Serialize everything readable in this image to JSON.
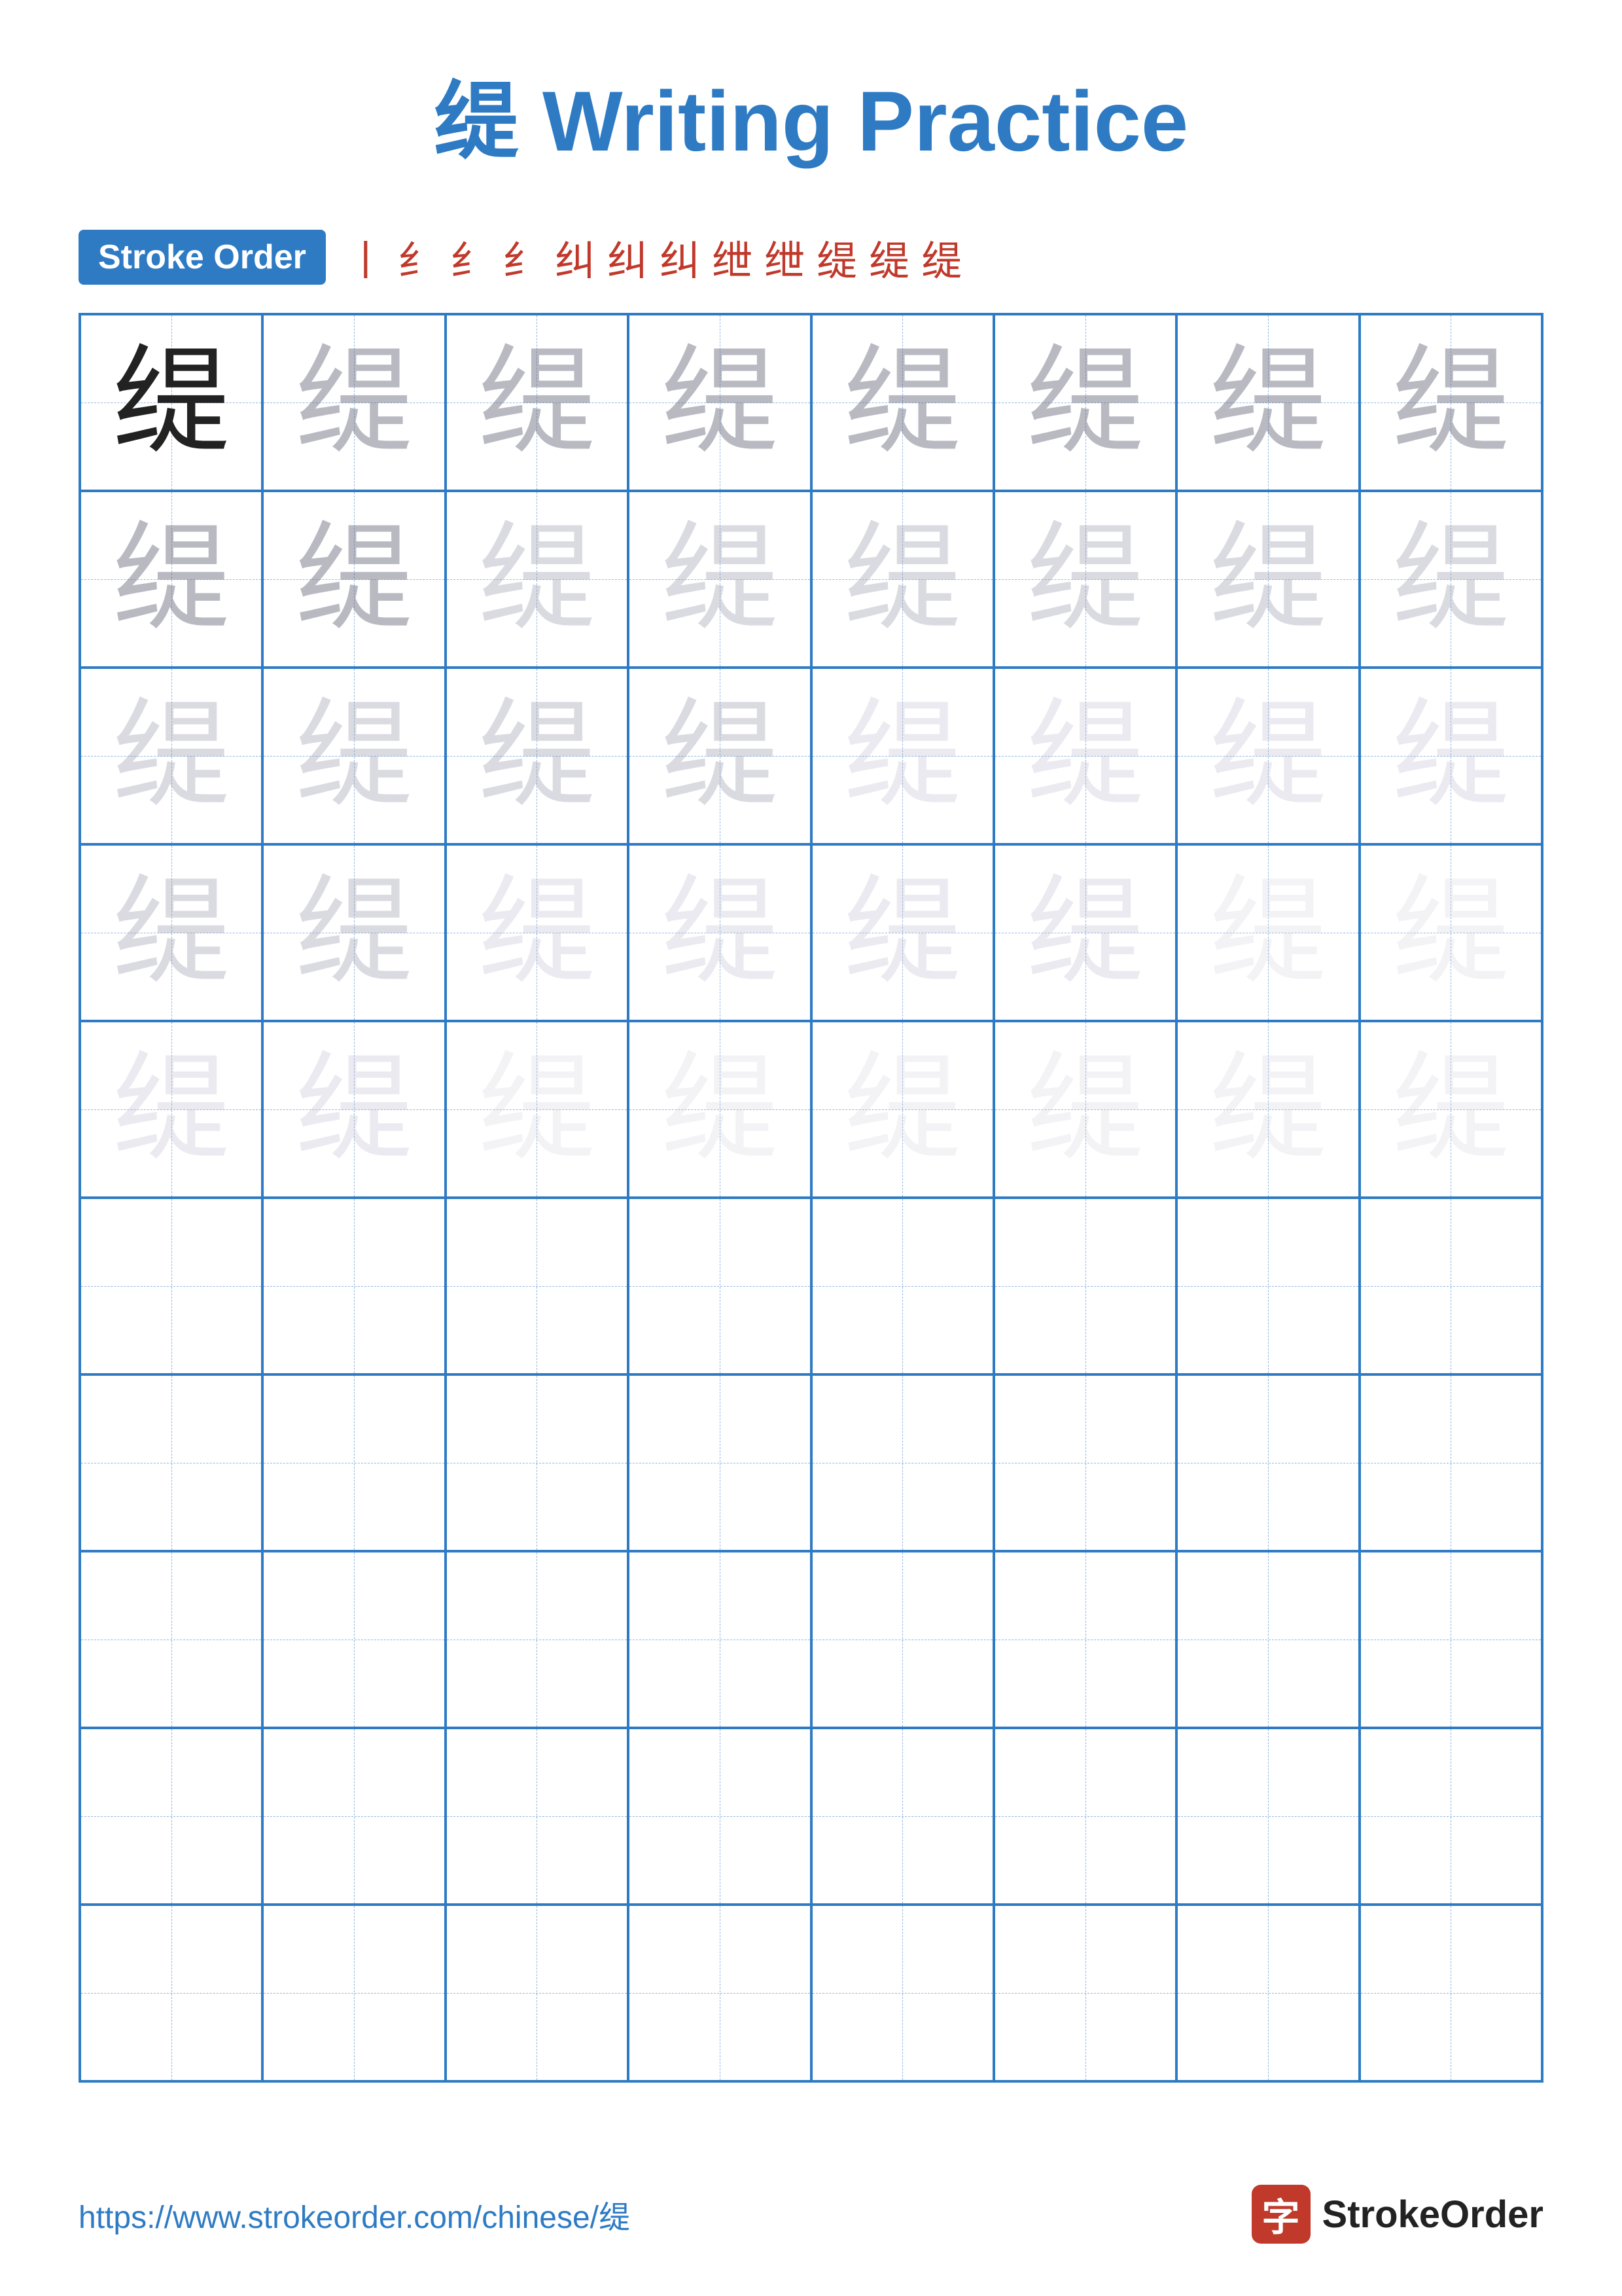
{
  "title": {
    "chinese": "缇",
    "english": " Writing Practice"
  },
  "stroke_order": {
    "badge_label": "Stroke Order",
    "strokes": [
      "㇀",
      "纟",
      "纟",
      "纟",
      "纠",
      "纠",
      "纠",
      "绁",
      "绁",
      "缇",
      "缇",
      "缇"
    ]
  },
  "character": "缇",
  "rows": [
    {
      "shades": [
        "dark",
        "light1",
        "light1",
        "light1",
        "light1",
        "light1",
        "light1",
        "light1"
      ]
    },
    {
      "shades": [
        "light1",
        "light1",
        "light2",
        "light2",
        "light2",
        "light2",
        "light2",
        "light2"
      ]
    },
    {
      "shades": [
        "light2",
        "light2",
        "light2",
        "light2",
        "light3",
        "light3",
        "light3",
        "light3"
      ]
    },
    {
      "shades": [
        "light2",
        "light2",
        "light3",
        "light3",
        "light3",
        "light3",
        "faint",
        "faint"
      ]
    },
    {
      "shades": [
        "light3",
        "light3",
        "faint",
        "faint",
        "faint",
        "faint",
        "faint",
        "faint"
      ]
    },
    {
      "shades": [
        "empty",
        "empty",
        "empty",
        "empty",
        "empty",
        "empty",
        "empty",
        "empty"
      ]
    },
    {
      "shades": [
        "empty",
        "empty",
        "empty",
        "empty",
        "empty",
        "empty",
        "empty",
        "empty"
      ]
    },
    {
      "shades": [
        "empty",
        "empty",
        "empty",
        "empty",
        "empty",
        "empty",
        "empty",
        "empty"
      ]
    },
    {
      "shades": [
        "empty",
        "empty",
        "empty",
        "empty",
        "empty",
        "empty",
        "empty",
        "empty"
      ]
    },
    {
      "shades": [
        "empty",
        "empty",
        "empty",
        "empty",
        "empty",
        "empty",
        "empty",
        "empty"
      ]
    }
  ],
  "footer": {
    "url": "https://www.strokeorder.com/chinese/缇",
    "logo_char": "字",
    "logo_text": "StrokeOrder"
  }
}
